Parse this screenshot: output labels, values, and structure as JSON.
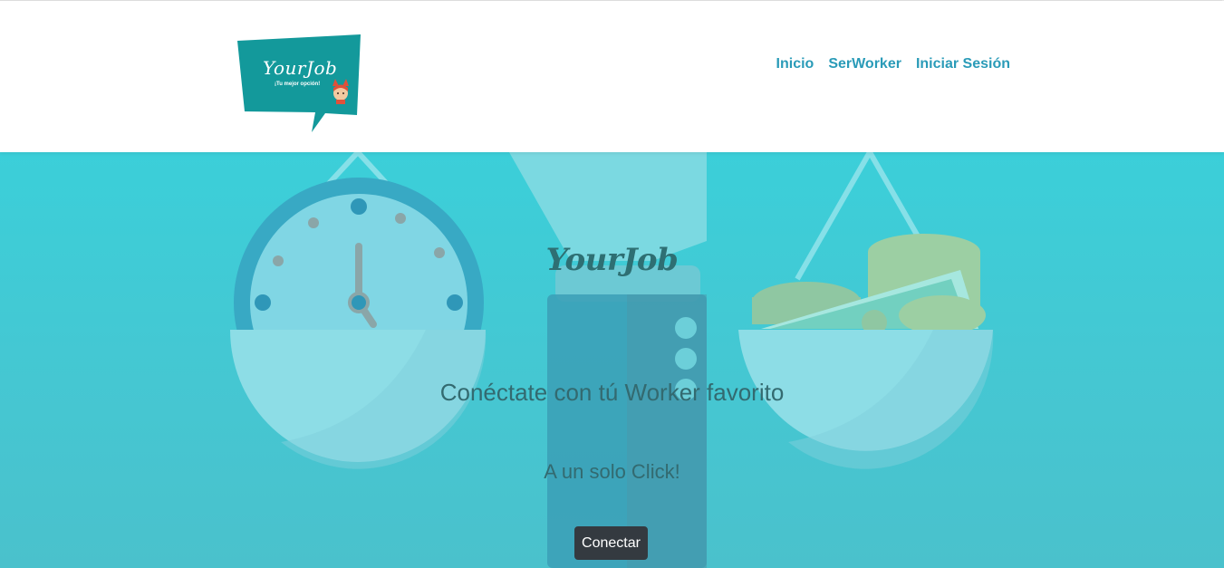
{
  "header": {
    "logo": {
      "title": "YourJob",
      "tagline": "¡Tu mejor opción!",
      "mascot": "fox-mascot-icon"
    },
    "nav": [
      {
        "label": "Inicio"
      },
      {
        "label": "SerWorker"
      },
      {
        "label": "Iniciar Sesión"
      }
    ]
  },
  "hero": {
    "title": "YourJob",
    "subtitle": "Conéctate con tú Worker favorito",
    "tagline": "A un solo Click!",
    "cta_label": "Conectar",
    "background_icons": [
      "clock-icon",
      "scale-icon",
      "money-stack-icon"
    ]
  },
  "colors": {
    "brand": "#13999b",
    "nav_link": "#2a9bb8",
    "hero_bg": "#3ccdd8",
    "button_bg": "#343a40"
  }
}
